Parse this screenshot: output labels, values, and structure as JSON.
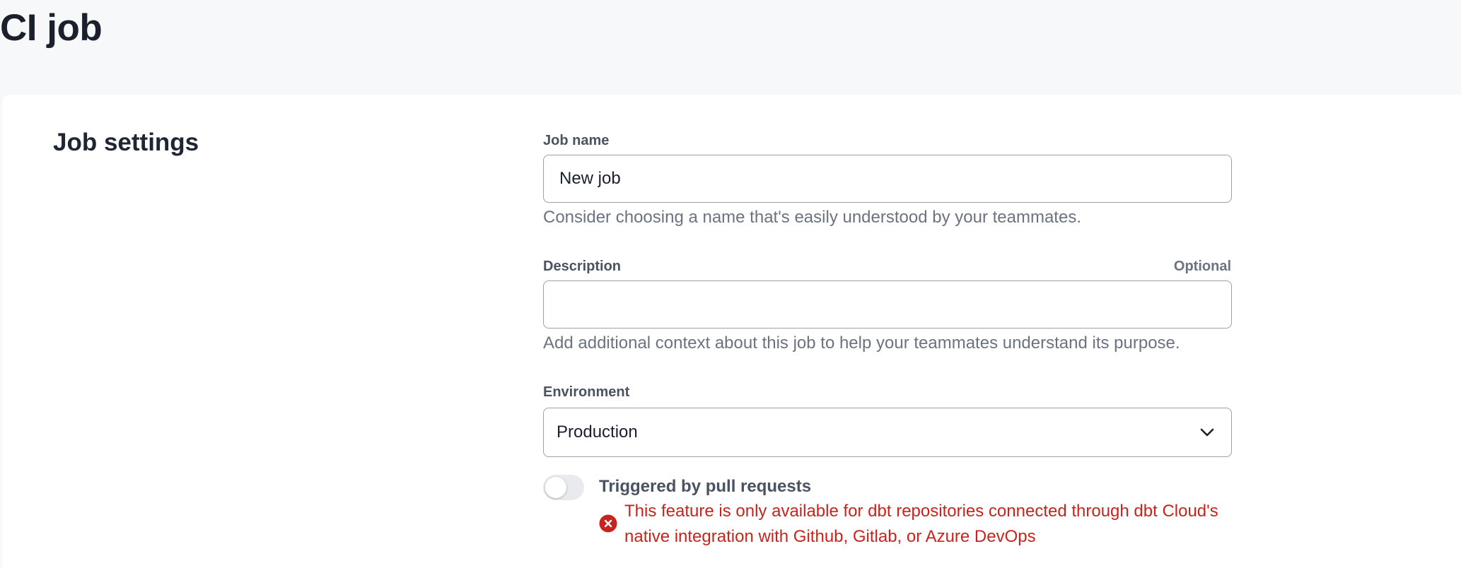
{
  "page": {
    "title": "CI job"
  },
  "section": {
    "title": "Job settings"
  },
  "job_name": {
    "label": "Job name",
    "value": "New job",
    "help": "Consider choosing a name that's easily understood by your teammates."
  },
  "description": {
    "label": "Description",
    "optional": "Optional",
    "value": "",
    "help": "Add additional context about this job to help your teammates understand its purpose."
  },
  "environment": {
    "label": "Environment",
    "selected": "Production"
  },
  "trigger": {
    "label": "Triggered by pull requests",
    "enabled": false,
    "error": "This feature is only available for dbt repositories connected through dbt Cloud's native integration with Github, Gitlab, or Azure DevOps"
  },
  "colors": {
    "error": "#c8241d",
    "background": "#f7f8fa",
    "card": "#ffffff"
  },
  "icons": {
    "select": "chevron-down-icon",
    "error": "error-circle-icon"
  }
}
